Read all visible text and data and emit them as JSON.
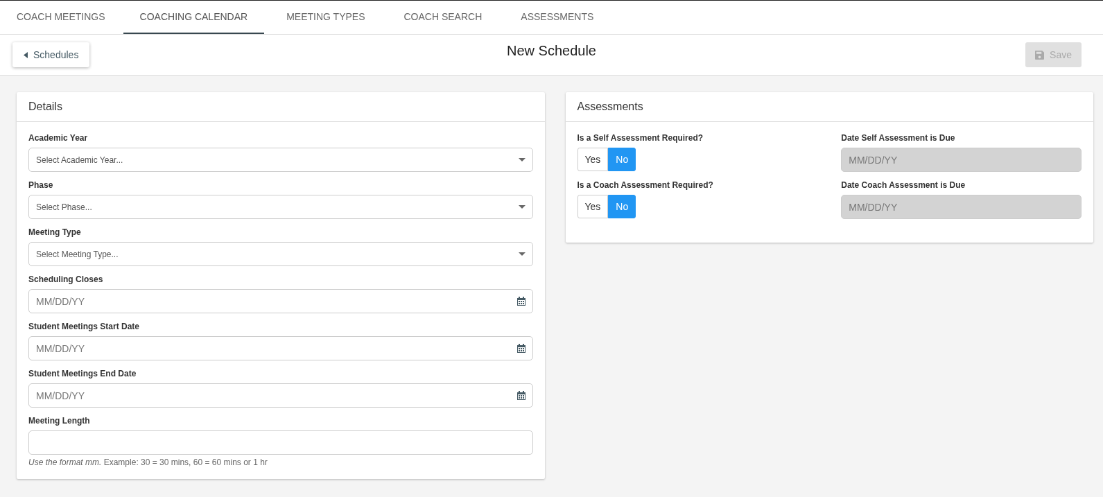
{
  "tabs": [
    {
      "label": "COACH MEETINGS",
      "selected": false
    },
    {
      "label": "COACHING CALENDAR",
      "selected": true
    },
    {
      "label": "MEETING TYPES",
      "selected": false
    },
    {
      "label": "COACH SEARCH",
      "selected": false
    },
    {
      "label": "ASSESSMENTS",
      "selected": false
    }
  ],
  "header": {
    "back_button": "Schedules",
    "title": "New Schedule",
    "save_button": {
      "label": "Save",
      "disabled": true
    }
  },
  "details": {
    "title": "Details",
    "fields": [
      {
        "kind": "select",
        "label": "Academic Year",
        "placeholder": "Select Academic Year..."
      },
      {
        "kind": "select",
        "label": "Phase",
        "placeholder": "Select Phase..."
      },
      {
        "kind": "select",
        "label": "Meeting Type",
        "placeholder": "Select Meeting Type..."
      },
      {
        "kind": "date",
        "label": "Scheduling Closes",
        "placeholder": "MM/DD/YY"
      },
      {
        "kind": "date",
        "label": "Student Meetings Start Date",
        "placeholder": "MM/DD/YY"
      },
      {
        "kind": "date",
        "label": "Student Meetings End Date",
        "placeholder": "MM/DD/YY"
      },
      {
        "kind": "text",
        "label": "Meeting Length",
        "hint": "*Use the format mm.* Example: 30 = 30 mins, 60 = 60 mins or 1 hr"
      }
    ]
  },
  "assessments": {
    "title": "Assessments",
    "rows": [
      {
        "question": "Is a Self Assessment Required?",
        "options": [
          {
            "label": "Yes",
            "selected": false
          },
          {
            "label": "No",
            "selected": true
          }
        ],
        "date_label": "Date Self Assessment is Due",
        "date_placeholder": "MM/DD/YY",
        "date_disabled": true
      },
      {
        "question": "Is a Coach Assessment Required?",
        "options": [
          {
            "label": "Yes",
            "selected": false
          },
          {
            "label": "No",
            "selected": true
          }
        ],
        "date_label": "Date Coach Assessment is Due",
        "date_placeholder": "MM/DD/YY",
        "date_disabled": true
      }
    ]
  }
}
